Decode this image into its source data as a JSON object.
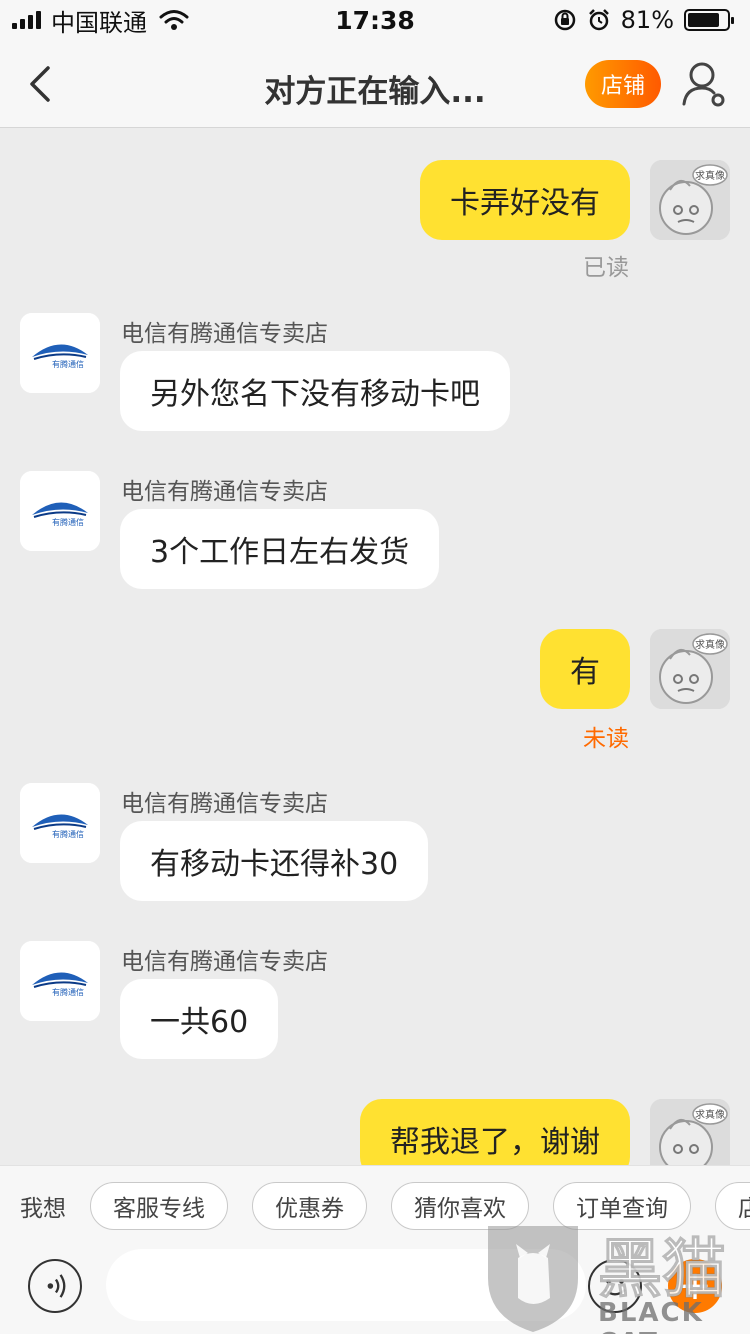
{
  "status": {
    "carrier": "中国联通",
    "time": "17:38",
    "battery": "81%",
    "battery_level": 0.81
  },
  "nav": {
    "title": "对方正在输入...",
    "shop_label": "店铺"
  },
  "avatars": {
    "me_badge": "求真像",
    "shop_logo_text": "有腾通信"
  },
  "messages": [
    {
      "dir": "out",
      "text": "卡弄好没有",
      "status": "已读"
    },
    {
      "dir": "in",
      "sender": "电信有腾通信专卖店",
      "text": "另外您名下没有移动卡吧"
    },
    {
      "dir": "in",
      "sender": "电信有腾通信专卖店",
      "text": "3个工作日左右发货"
    },
    {
      "dir": "out",
      "text": "有",
      "status": "未读"
    },
    {
      "dir": "in",
      "sender": "电信有腾通信专卖店",
      "text": "有移动卡还得补30"
    },
    {
      "dir": "in",
      "sender": "电信有腾通信专卖店",
      "text": "一共60"
    },
    {
      "dir": "out",
      "text": "帮我退了，谢谢"
    }
  ],
  "quick": {
    "label": "我想",
    "chips": [
      "客服专线",
      "优惠券",
      "猜你喜欢",
      "订单查询",
      "店铺"
    ]
  },
  "input": {
    "placeholder": ""
  },
  "watermark": {
    "text": "黑猫",
    "sub": "BLACK CAT"
  },
  "colors": {
    "accent": "#ff7a00",
    "bubble_out": "#ffe131",
    "unread": "#ff6a00"
  }
}
